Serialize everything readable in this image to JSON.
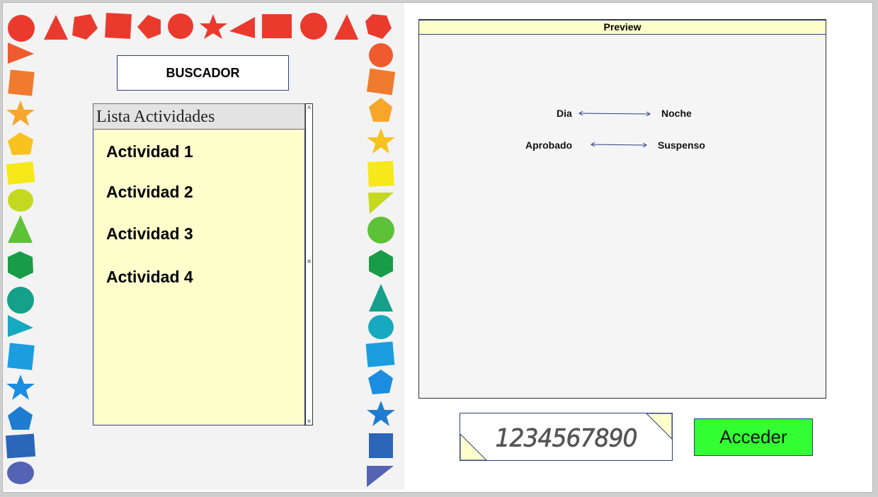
{
  "search": {
    "label": "BUSCADOR"
  },
  "activity_list": {
    "header": "Lista Actividades",
    "items": [
      "Actividad 1",
      "Actividad 2",
      "Actividad 3",
      "Actividad 4"
    ],
    "scroll_up": "˄",
    "scroll_down": "˅",
    "scroll_grip": "≡"
  },
  "preview": {
    "title": "Preview",
    "pairs": [
      {
        "left": "Dia",
        "right": "Noche"
      },
      {
        "left": "Aprobado",
        "right": "Suspenso"
      }
    ]
  },
  "code": {
    "value": "1234567890"
  },
  "access": {
    "label": "Acceder"
  },
  "colors": {
    "list_bg": "#ffffcc",
    "access_bg": "#33ff33",
    "border_accent": "#2e3f7f",
    "preview_bg": "#f5f5f5"
  }
}
